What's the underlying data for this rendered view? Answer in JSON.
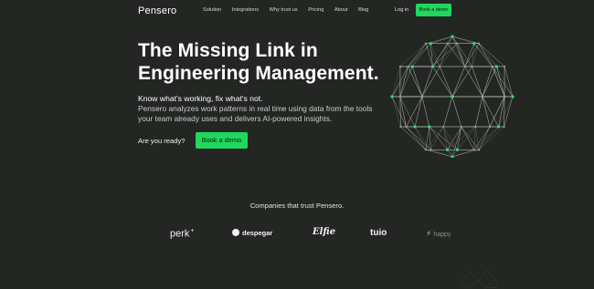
{
  "nav": {
    "logo": "Pensero",
    "items": [
      "Solution",
      "Integrations",
      "Why trust us",
      "Pricing",
      "About",
      "Blog"
    ],
    "login": "Log in",
    "cta": "Book a demo"
  },
  "hero": {
    "headline_line1": "The Missing Link in",
    "headline_line2": "Engineering Management.",
    "subhead": "Know what's working, fix what's not.",
    "description": "Pensero analyzes work patterns in real time using data from the tools your team already uses and delivers AI-powered insights.",
    "cta_label": "Are you ready?",
    "cta_button": "Book a demo"
  },
  "trust": {
    "heading": "Companies that trust Pensero.",
    "logos": {
      "perk": "perk",
      "perk_sup": "+",
      "despegar": "despegar",
      "elfie": "Elfie",
      "tuio": "tuio",
      "last": "happy"
    }
  },
  "colors": {
    "background": "#232623",
    "accent": "#1fd85e",
    "node": "#2fe06a",
    "edge": "#c8ccc8"
  }
}
